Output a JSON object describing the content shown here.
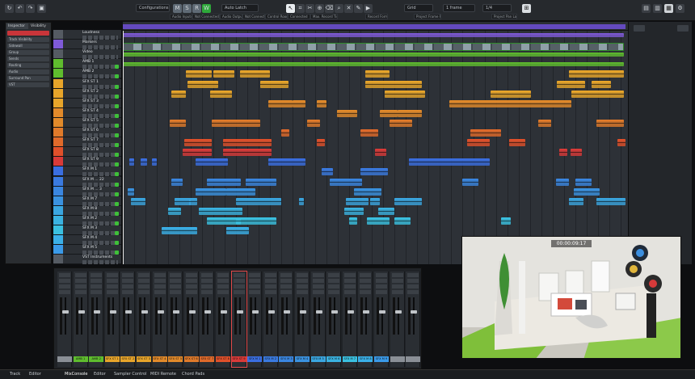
{
  "toolbar": {
    "configurations": "Configurations",
    "automation": "Auto Latch",
    "grid": "Grid",
    "quantize": "1 frame",
    "zoom": "1/4",
    "status": [
      "Audio Inputs",
      "Not Connected",
      "Audio Outputs",
      "Not Connected",
      "Control Room",
      "Connected",
      "Max. Record Time",
      "Record Format",
      "Project Frame Rate",
      "Project Pan Law"
    ]
  },
  "inspector": {
    "tabs": [
      "Inspector",
      "Visibility"
    ],
    "items": [
      "Track Visibility",
      "Sidewall",
      "Group",
      "Sends",
      "Routing",
      "Audio",
      "Surround Pan",
      "VST"
    ]
  },
  "tracks": [
    {
      "name": "Loudness",
      "color": "#555b63"
    },
    {
      "name": "Markers",
      "color": "#7f5ad8"
    },
    {
      "name": "Video",
      "color": "#555b63"
    },
    {
      "name": "AMB 1",
      "color": "#5fbd2e"
    },
    {
      "name": "AMB 2",
      "color": "#5fbd2e"
    },
    {
      "name": "SFX ST 1",
      "color": "#e8a52a"
    },
    {
      "name": "SFX ST 2",
      "color": "#e8a52a"
    },
    {
      "name": "SFX ST 3",
      "color": "#e8a52a"
    },
    {
      "name": "SFX ST 4",
      "color": "#e28a2a"
    },
    {
      "name": "SFX ST 5",
      "color": "#e28a2a"
    },
    {
      "name": "SFX ST 6",
      "color": "#e07a2a"
    },
    {
      "name": "SFX ST 7",
      "color": "#e06a2a"
    },
    {
      "name": "SFX ST 8",
      "color": "#e0502a"
    },
    {
      "name": "SFX ST 9",
      "color": "#d93a38"
    },
    {
      "name": "SFX M 1",
      "color": "#3a6ee0"
    },
    {
      "name": "SFX M ... 22",
      "color": "#3a7ae0"
    },
    {
      "name": "SFX M ... 3",
      "color": "#3a86e0"
    },
    {
      "name": "SFX M 7",
      "color": "#3a92e0"
    },
    {
      "name": "SFX M 8",
      "color": "#3aa6e0"
    },
    {
      "name": "SFX M 2",
      "color": "#3ab2e0"
    },
    {
      "name": "SFX M 3",
      "color": "#3ac0e0"
    },
    {
      "name": "SFX M 4",
      "color": "#3ab0e8"
    },
    {
      "name": "SFX M 5",
      "color": "#3a9ae8"
    },
    {
      "name": "VST Instruments",
      "color": "#555b63"
    }
  ],
  "mixer": {
    "channels": [
      {
        "label": "",
        "color": "#8a8f96"
      },
      {
        "label": "AMB 1",
        "color": "#5fbd2e"
      },
      {
        "label": "AMB 2",
        "color": "#5fbd2e"
      },
      {
        "label": "SFX ST 1",
        "color": "#e8a52a"
      },
      {
        "label": "SFX ST 2",
        "color": "#e8a52a"
      },
      {
        "label": "SFX ST 3",
        "color": "#e8a52a"
      },
      {
        "label": "SFX ST 4",
        "color": "#e28a2a"
      },
      {
        "label": "SFX ST 5",
        "color": "#e28a2a"
      },
      {
        "label": "SFX ST 6",
        "color": "#e07a2a"
      },
      {
        "label": "SFX ST 7",
        "color": "#e06a2a"
      },
      {
        "label": "SFX ST 8",
        "color": "#e0502a"
      },
      {
        "label": "SFX ST 9",
        "color": "#d93a38"
      },
      {
        "label": "SFX M 1",
        "color": "#3a6ee0"
      },
      {
        "label": "SFX M 2",
        "color": "#3a7ae0"
      },
      {
        "label": "SFX M 3",
        "color": "#3a86e0"
      },
      {
        "label": "SFX M 4",
        "color": "#3a92e0"
      },
      {
        "label": "SFX M 5",
        "color": "#3aa6e0"
      },
      {
        "label": "SFX M 6",
        "color": "#3ab2e0"
      },
      {
        "label": "SFX M 7",
        "color": "#3ac0e0"
      },
      {
        "label": "SFX M 8",
        "color": "#3ab0e8"
      },
      {
        "label": "SFX M 9",
        "color": "#3a9ae8"
      },
      {
        "label": "",
        "color": "#8a8f96"
      },
      {
        "label": "",
        "color": "#8a8f96"
      }
    ]
  },
  "video": {
    "timecode": "00:00:09:17"
  },
  "bottom_tabs": [
    "Track",
    "Editor",
    "MixConsole",
    "Editor",
    "Sampler Control",
    "MIDI Remote",
    "Chord Pads"
  ]
}
